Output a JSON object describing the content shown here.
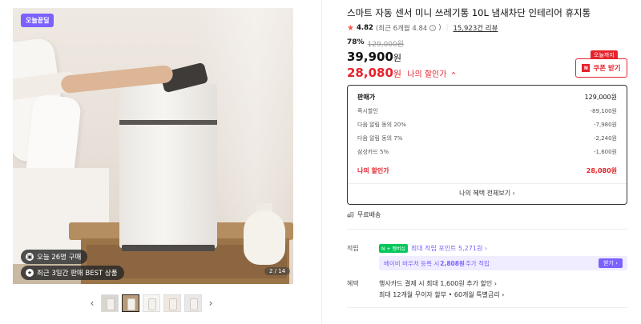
{
  "gallery": {
    "badge": "오늘끝딜",
    "pill_today": "오늘 26명 구매",
    "pill_best": "최근 3일간 판매 BEST 상품",
    "counter": "2 / 14",
    "prev_arrow": "‹",
    "next_arrow": "›"
  },
  "product": {
    "title": "스마트 자동 센서 미니 쓰레기통 10L 냄새차단 인테리어 휴지통",
    "rating": "4.82",
    "rating_sub": "(최근 6개월 4.84",
    "rating_close": ")",
    "reviews": "15,923건 리뷰",
    "discount_pct": "78%",
    "original_price": "129,000원",
    "price_num": "39,900",
    "price_unit": "원",
    "my_price_num": "28,080",
    "my_price_unit": "원",
    "my_price_label": "나의 할인가",
    "chevron": "^"
  },
  "coupon": {
    "tag": "오늘까지",
    "icon_letter": "N",
    "label": "쿠폰 받기"
  },
  "breakdown": {
    "rows": [
      {
        "label": "판매가",
        "value": "129,000원"
      },
      {
        "label": "즉시할인",
        "value": "-89,100원"
      },
      {
        "label": "다음 알림 동의 20%",
        "value": "-7,980원"
      },
      {
        "label": "다음 알림 동의 7%",
        "value": "-2,240원"
      },
      {
        "label": "삼성카드 5%",
        "value": "-1,600원"
      }
    ],
    "mine_label": "나의 할인가",
    "mine_value": "28,080원",
    "more": "나의 혜택 전체보기 ›"
  },
  "shipping": {
    "text": "무료배송"
  },
  "points": {
    "label": "적립",
    "badge_np": "N + 멤버십",
    "text": "최대 적립 포인트 5,271원 ›",
    "promo_pre": "베이비 바우처 등록 시 ",
    "promo_amount": "2,808원",
    "promo_post": " 추가 적립",
    "promo_btn": "받기 ›"
  },
  "benefits": {
    "label": "혜택",
    "line1": "행사카드 결제 시 최대 1,600원 추가 할인 ›",
    "line2": "최대 12개월 무이자 할부 • 60개월 특별금리 ›"
  },
  "colors": {
    "accent_red": "#e6232c",
    "accent_purple": "#7b61ff",
    "naver_green": "#03c75a"
  }
}
